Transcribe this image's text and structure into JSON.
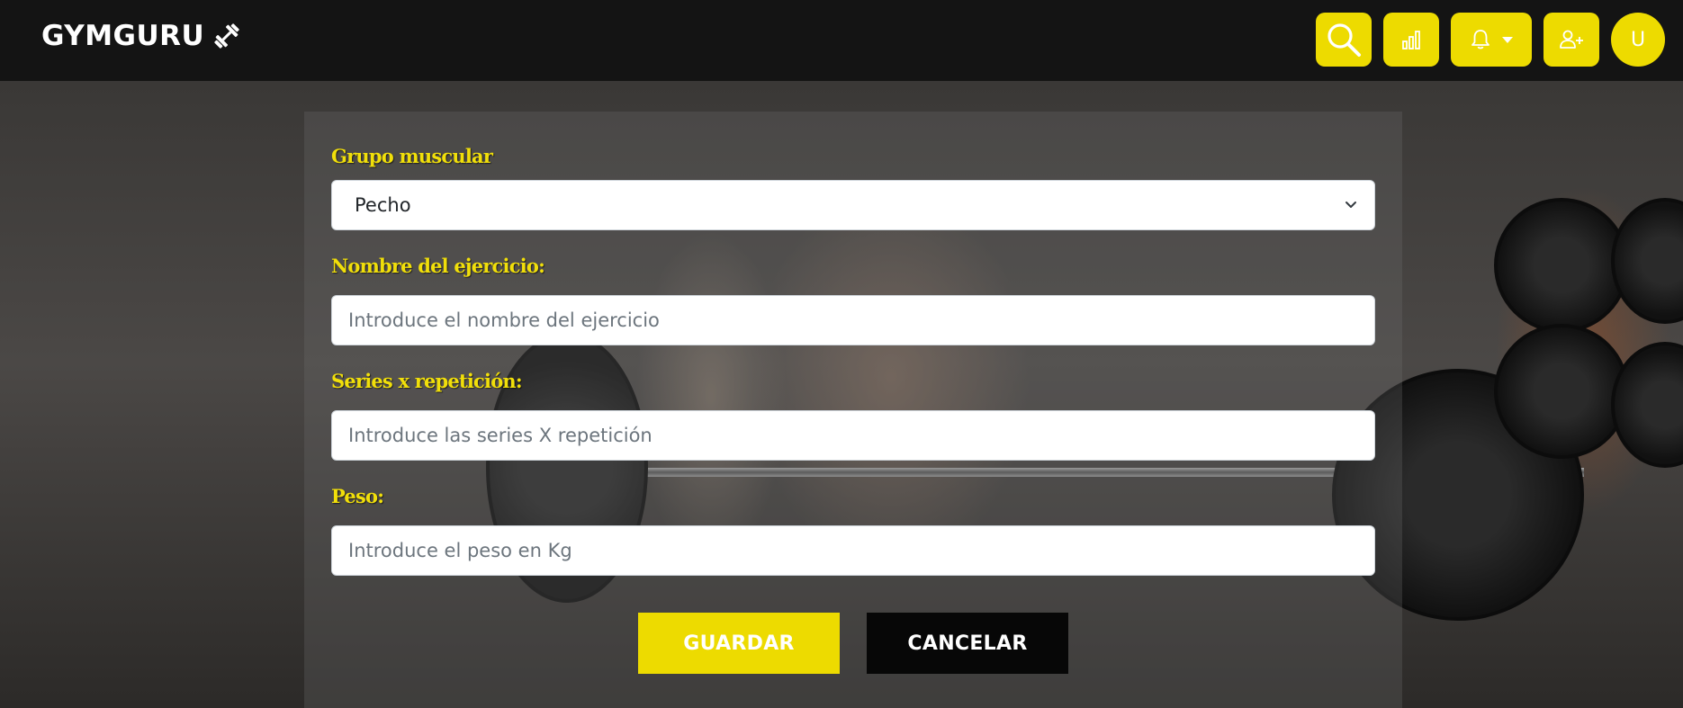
{
  "navbar": {
    "brand": "GYMGURU",
    "brand_icon": "dumbbell-icon",
    "accent_color": "#eddb00",
    "actions": [
      {
        "name": "search-button",
        "icon": "search-icon"
      },
      {
        "name": "stats-button",
        "icon": "bar-chart-icon"
      },
      {
        "name": "notifications-button",
        "icon": "bell-icon"
      },
      {
        "name": "add-user-button",
        "icon": "user-plus-icon"
      }
    ],
    "avatar_initial": "U"
  },
  "form": {
    "muscle_group": {
      "label": "Grupo muscular",
      "selected": "Pecho"
    },
    "exercise_name": {
      "label": "Nombre del ejercicio:",
      "placeholder": "Introduce el nombre del ejercicio"
    },
    "series": {
      "label": "Series x repetición:",
      "placeholder": "Introduce las series X repetición"
    },
    "weight": {
      "label": "Peso:",
      "placeholder": "Introduce el peso en Kg"
    },
    "save_label": "GUARDAR",
    "cancel_label": "CANCELAR"
  }
}
